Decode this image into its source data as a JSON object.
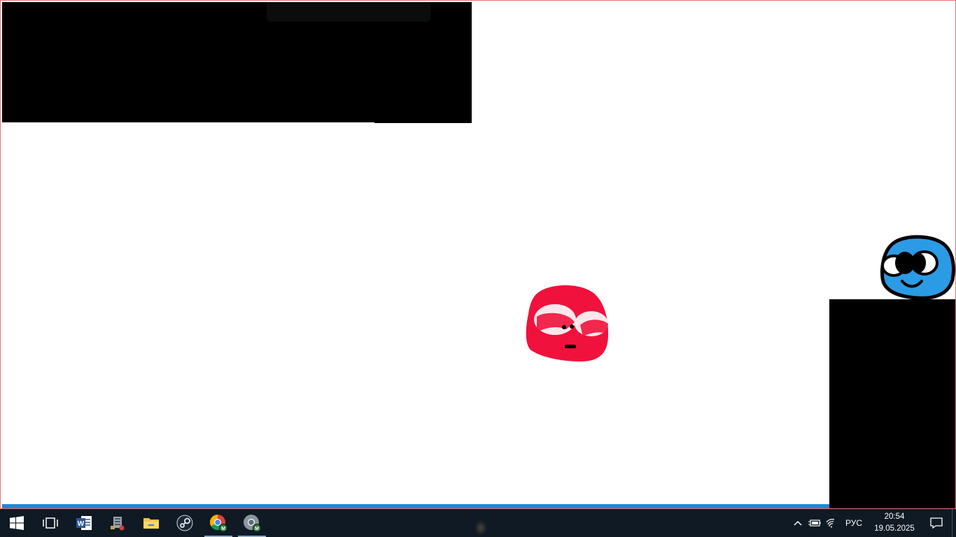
{
  "game": {
    "colors": {
      "background": "#ffffff",
      "blocks": "#000000",
      "ground": "#1e88d2",
      "frame_border": "#e8706e",
      "red_blob": "#f0123c",
      "blue_blob": "#2b9be6"
    },
    "characters": [
      {
        "name": "red-blob",
        "color": "#f0123c"
      },
      {
        "name": "blue-blob",
        "color": "#2b9be6"
      }
    ]
  },
  "taskbar": {
    "apps": [
      {
        "name": "start",
        "icon": "windows-logo-icon"
      },
      {
        "name": "task-view",
        "icon": "task-view-icon"
      },
      {
        "name": "word",
        "icon": "word-icon"
      },
      {
        "name": "installer",
        "icon": "installer-icon"
      },
      {
        "name": "file-explorer",
        "icon": "folder-icon"
      },
      {
        "name": "steam",
        "icon": "steam-icon"
      },
      {
        "name": "chrome",
        "icon": "chrome-icon"
      },
      {
        "name": "chrome-alt",
        "icon": "chrome-alt-icon"
      }
    ],
    "tray": {
      "language": "РУС",
      "time": "20:54",
      "date": "19.05.2025"
    }
  }
}
